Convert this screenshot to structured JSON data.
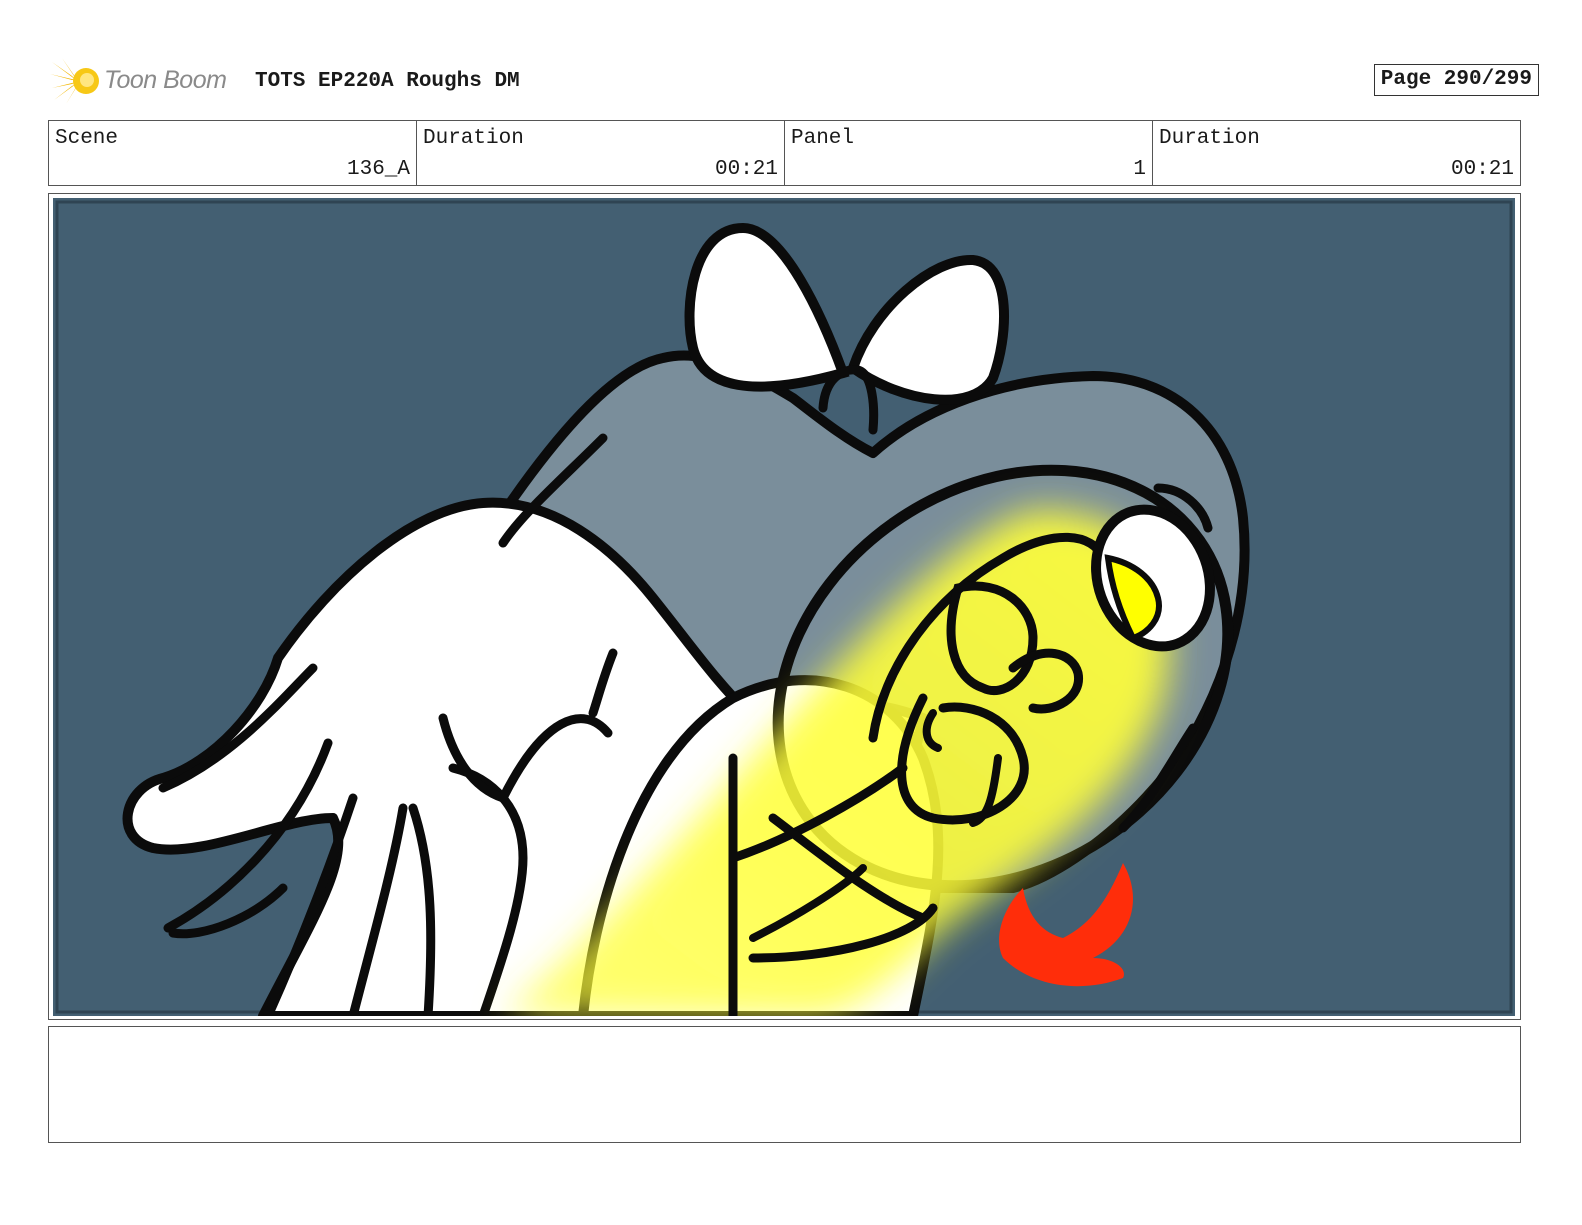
{
  "header": {
    "brand_name": "Toon Boom",
    "document_title": "TOTS EP220A Roughs DM",
    "page_indicator": "Page 290/299"
  },
  "info": {
    "scene_label": "Scene",
    "scene_value": "136_A",
    "scene_duration_label": "Duration",
    "scene_duration_value": "00:21",
    "panel_label": "Panel",
    "panel_value": "1",
    "panel_duration_label": "Duration",
    "panel_duration_value": "00:21"
  },
  "panel": {
    "background_color": "#435f72",
    "glow_color": "#ffff3a",
    "arrow_color": "#ff2d0a"
  },
  "notes": {
    "text": ""
  }
}
